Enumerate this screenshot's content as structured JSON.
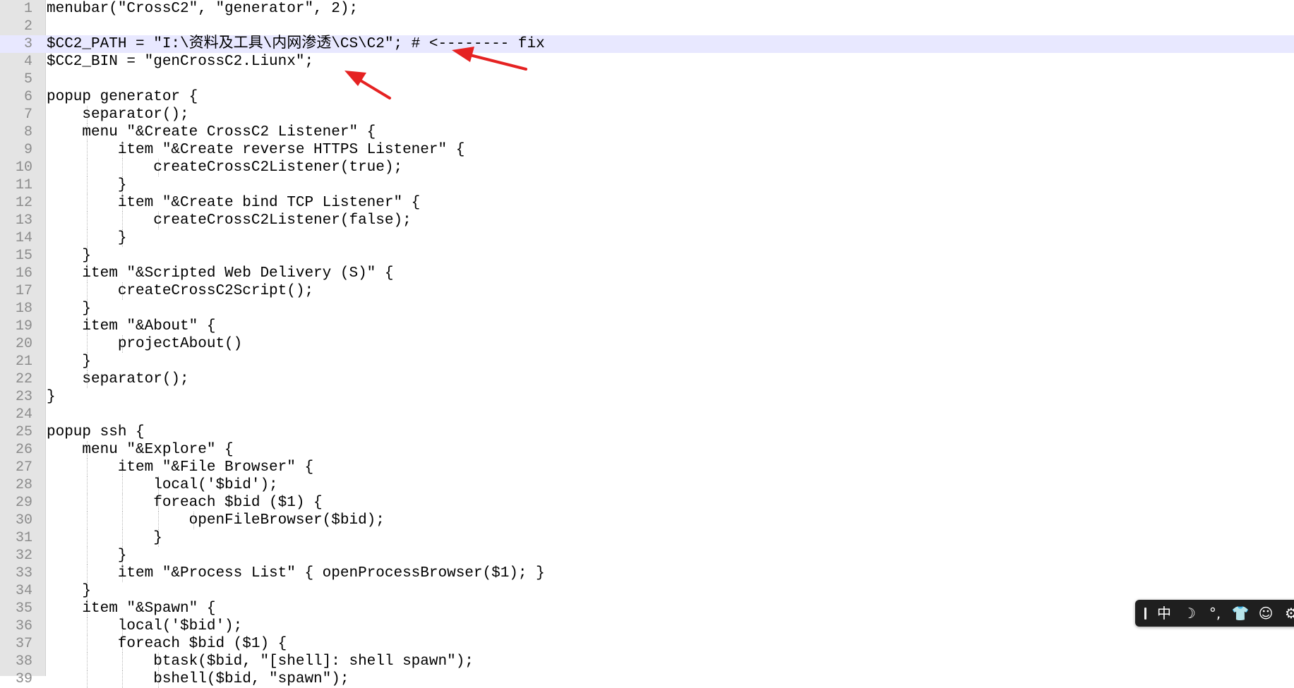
{
  "editor": {
    "current_line": 3,
    "lines": [
      {
        "n": "1",
        "text": "menubar(\"CrossC2\", \"generator\", 2);"
      },
      {
        "n": "2",
        "text": ""
      },
      {
        "n": "3",
        "text": "$CC2_PATH = \"I:\\资料及工具\\内网渗透\\CS\\C2\"; # <-------- fix"
      },
      {
        "n": "4",
        "text": "$CC2_BIN = \"genCrossC2.Liunx\";"
      },
      {
        "n": "5",
        "text": ""
      },
      {
        "n": "6",
        "text": "popup generator {"
      },
      {
        "n": "7",
        "text": "    separator();"
      },
      {
        "n": "8",
        "text": "    menu \"&Create CrossC2 Listener\" {"
      },
      {
        "n": "9",
        "text": "        item \"&Create reverse HTTPS Listener\" {"
      },
      {
        "n": "10",
        "text": "            createCrossC2Listener(true);"
      },
      {
        "n": "11",
        "text": "        }"
      },
      {
        "n": "12",
        "text": "        item \"&Create bind TCP Listener\" {"
      },
      {
        "n": "13",
        "text": "            createCrossC2Listener(false);"
      },
      {
        "n": "14",
        "text": "        }"
      },
      {
        "n": "15",
        "text": "    }"
      },
      {
        "n": "16",
        "text": "    item \"&Scripted Web Delivery (S)\" {"
      },
      {
        "n": "17",
        "text": "        createCrossC2Script();"
      },
      {
        "n": "18",
        "text": "    }"
      },
      {
        "n": "19",
        "text": "    item \"&About\" {"
      },
      {
        "n": "20",
        "text": "        projectAbout()"
      },
      {
        "n": "21",
        "text": "    }"
      },
      {
        "n": "22",
        "text": "    separator();"
      },
      {
        "n": "23",
        "text": "}"
      },
      {
        "n": "24",
        "text": ""
      },
      {
        "n": "25",
        "text": "popup ssh {"
      },
      {
        "n": "26",
        "text": "    menu \"&Explore\" {"
      },
      {
        "n": "27",
        "text": "        item \"&File Browser\" {"
      },
      {
        "n": "28",
        "text": "            local('$bid');"
      },
      {
        "n": "29",
        "text": "            foreach $bid ($1) {"
      },
      {
        "n": "30",
        "text": "                openFileBrowser($bid);"
      },
      {
        "n": "31",
        "text": "            }"
      },
      {
        "n": "32",
        "text": "        }"
      },
      {
        "n": "33",
        "text": "        item \"&Process List\" { openProcessBrowser($1); }"
      },
      {
        "n": "34",
        "text": "    }"
      },
      {
        "n": "35",
        "text": "    item \"&Spawn\" {"
      },
      {
        "n": "36",
        "text": "        local('$bid');"
      },
      {
        "n": "37",
        "text": "        foreach $bid ($1) {"
      },
      {
        "n": "38",
        "text": "            btask($bid, \"[shell]: shell spawn\");"
      },
      {
        "n": "39",
        "text": "            bshell($bid, \"spawn\");"
      }
    ]
  },
  "annotation": {
    "arrow_color": "#e52222",
    "targets": [
      "line-3-path-value",
      "line-4-bin-value"
    ]
  },
  "ime_toolbar": {
    "buttons": [
      {
        "name": "ime-mode-button",
        "glyph": "中"
      },
      {
        "name": "moon-icon",
        "glyph": "☽"
      },
      {
        "name": "punctuation-icon",
        "glyph": "°,"
      },
      {
        "name": "shirt-icon",
        "glyph": "👕"
      },
      {
        "name": "smiley-icon",
        "glyph": "☺"
      },
      {
        "name": "gear-icon",
        "glyph": "⚙"
      }
    ]
  }
}
